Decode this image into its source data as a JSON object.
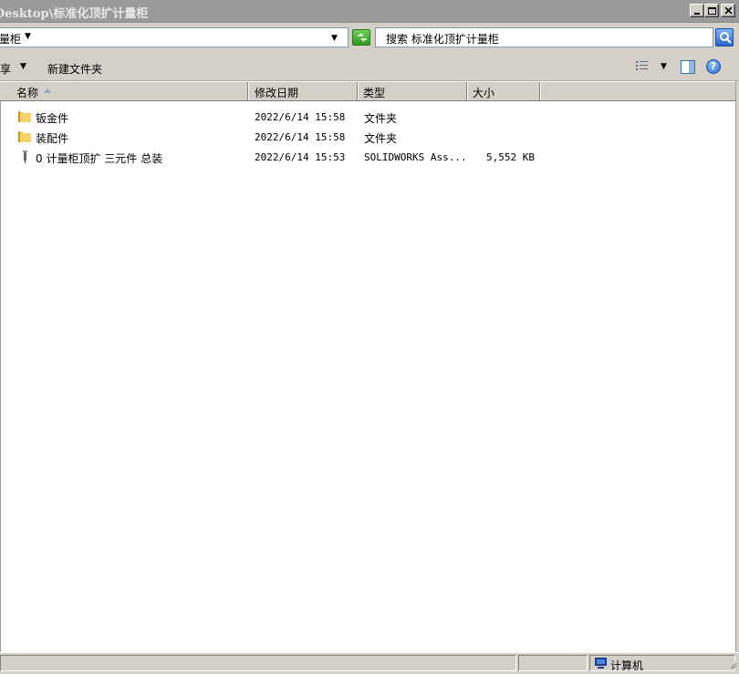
{
  "window": {
    "title": "Desktop\\标准化顶扩计量柜"
  },
  "address": {
    "path": "量柜",
    "search_placeholder": "搜索 标准化顶扩计量柜"
  },
  "toolbar": {
    "share_label": "享",
    "new_folder_label": "新建文件夹"
  },
  "columns": {
    "name": "名称",
    "date": "修改日期",
    "type": "类型",
    "size": "大小"
  },
  "files": [
    {
      "name": "钣金件",
      "date": "2022/6/14 15:58",
      "type": "文件夹",
      "size": "",
      "icon": "folder-icon"
    },
    {
      "name": "装配件",
      "date": "2022/6/14 15:58",
      "type": "文件夹",
      "size": "",
      "icon": "folder-icon"
    },
    {
      "name": "0 计量柜顶扩 三元件 总装",
      "date": "2022/6/14 15:53",
      "type": "SOLIDWORKS Ass...",
      "size": "5,552 KB",
      "icon": "solidworks-assembly-icon"
    }
  ],
  "statusbar": {
    "zone": "计算机"
  },
  "colors": {
    "chrome": "#d4d0c8",
    "titlebar": "#9a9a9a",
    "folder": "#f2c94c"
  }
}
